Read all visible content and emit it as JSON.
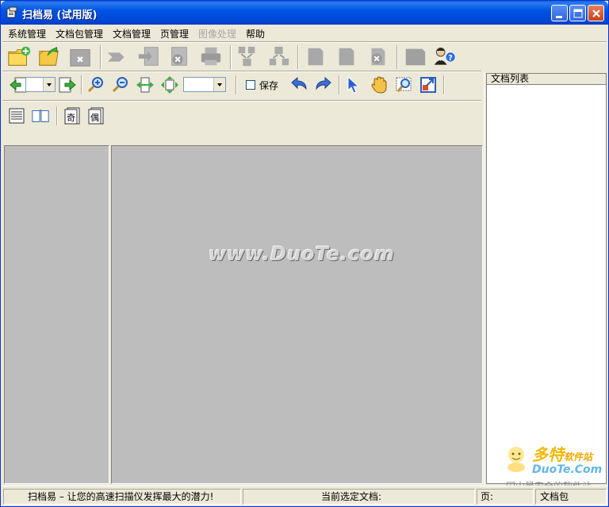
{
  "window": {
    "title": "扫档易 (试用版)"
  },
  "menu": {
    "items": [
      "系统管理",
      "文档包管理",
      "文档管理",
      "页管理",
      "图像处理",
      "帮助"
    ]
  },
  "toolbar2": {
    "save_label": "保存"
  },
  "toolbar3": {
    "odd_label": "奇",
    "even_label": "偶"
  },
  "main": {
    "watermark": "www.DuoTe.com"
  },
  "doc_list": {
    "header": "文档列表"
  },
  "logo": {
    "big": "多特",
    "big_suffix": "软件站",
    "small": "DuoTe.Com",
    "sub": "国内最安全的软件站"
  },
  "status": {
    "slogan": "扫档易 – 让您的高速扫描仪发挥最大的潜力!",
    "current_doc_label": "当前选定文档:",
    "page_label": "页:",
    "package_label": "文档包"
  },
  "colors": {
    "titlebar": "#0054e3",
    "panel_bg": "#bdbdbd",
    "window_bg": "#ece9d8",
    "accent_blue": "#2b5fd9"
  }
}
